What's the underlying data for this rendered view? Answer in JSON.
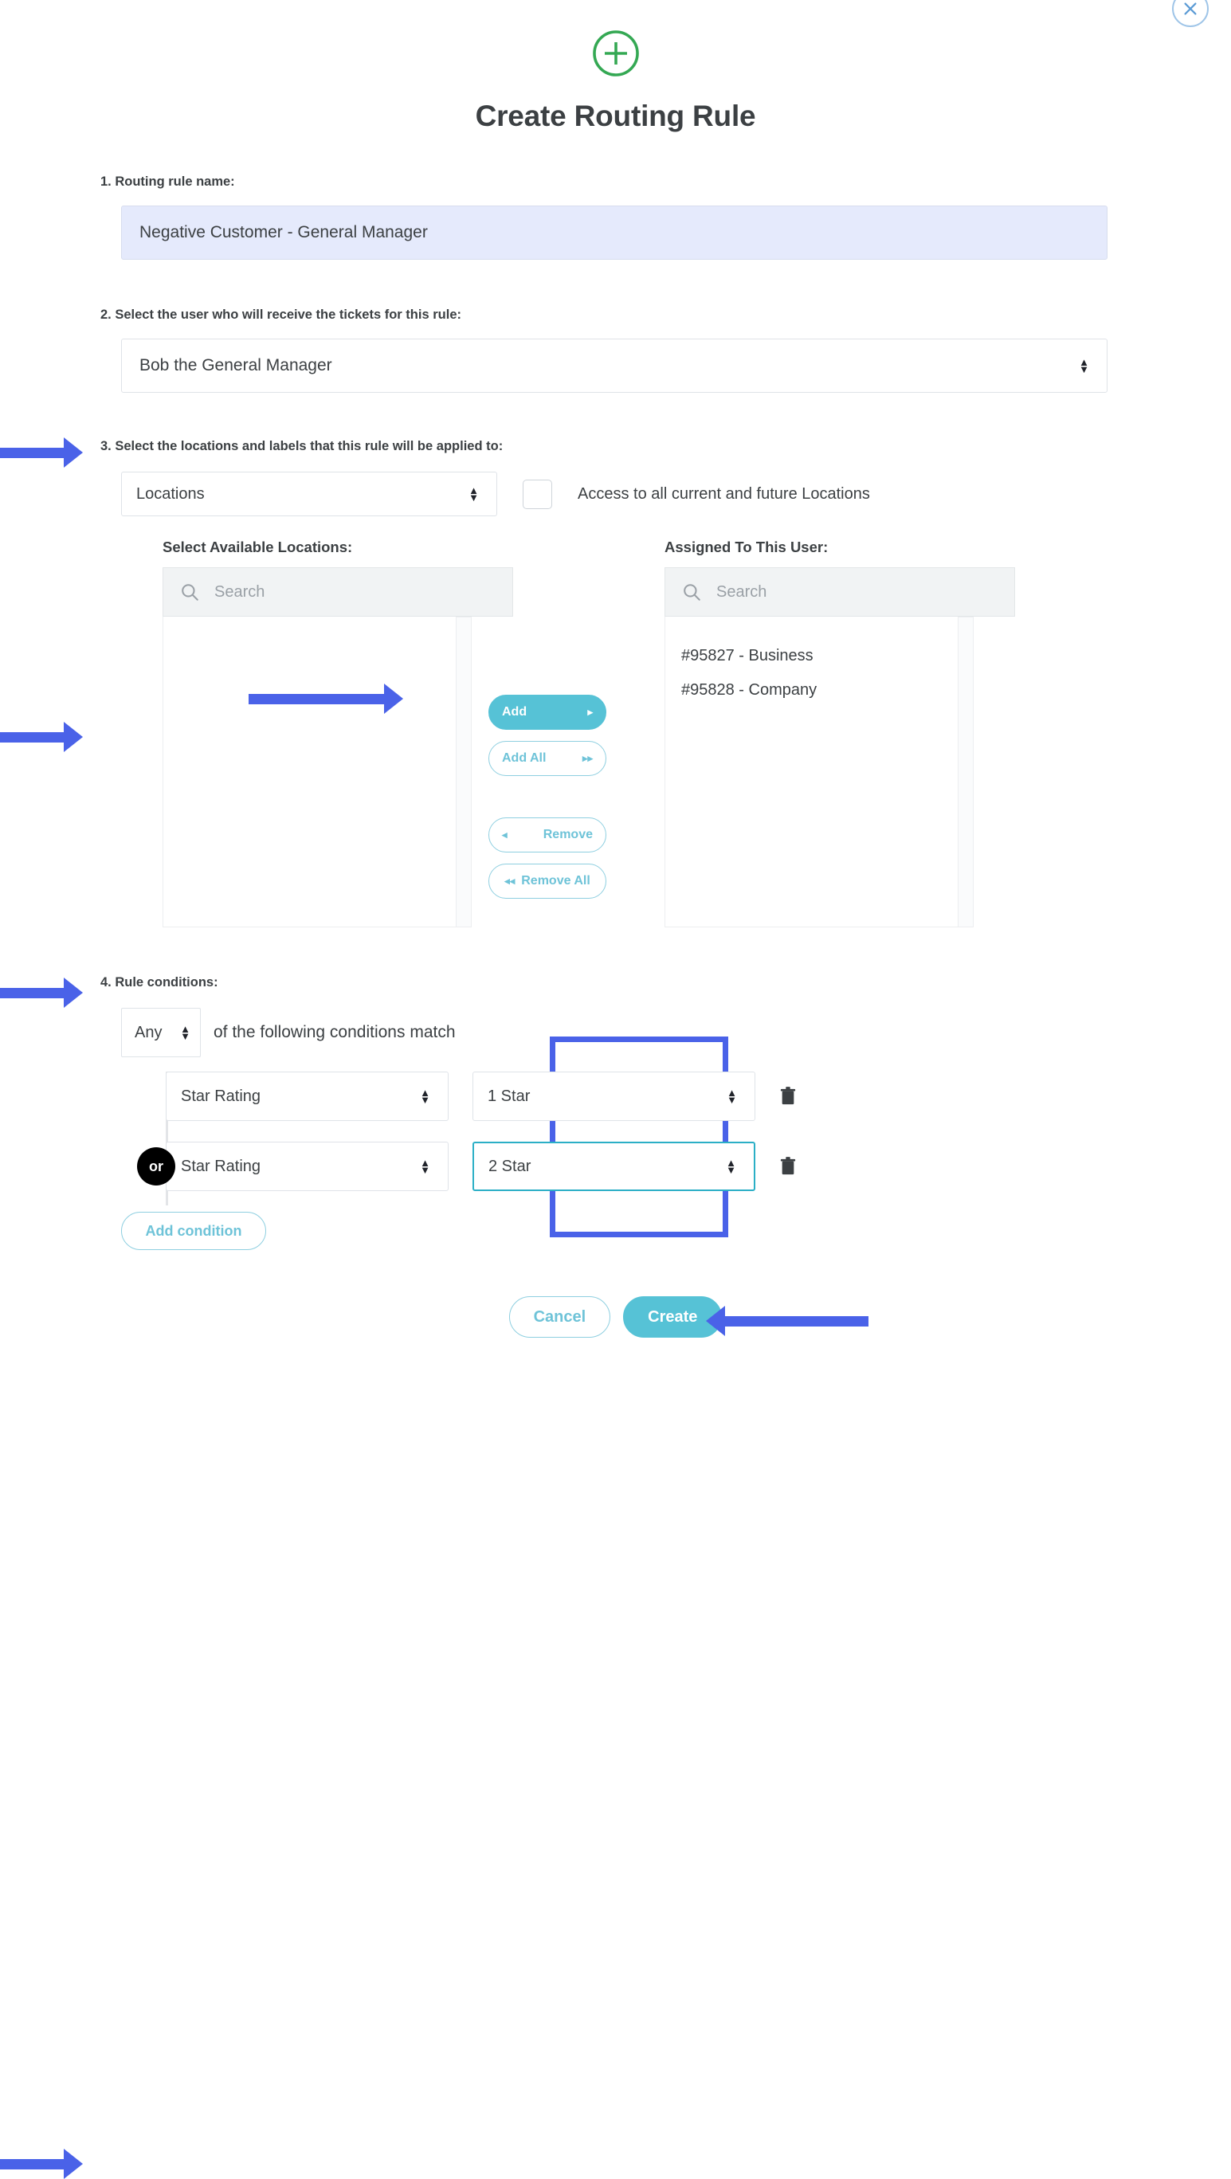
{
  "window": {
    "close_icon": "close-icon"
  },
  "header": {
    "plus_icon": "plus-circle-icon",
    "title": "Create Routing Rule",
    "accent_green": "#34a853"
  },
  "step1": {
    "label": "1. Routing rule name:",
    "value": "Negative Customer - General Manager",
    "highlight_bg": "#e5eafc"
  },
  "step2": {
    "label": "2. Select the user who will receive the tickets for this rule:",
    "value": "Bob the General Manager"
  },
  "step3": {
    "label": "3. Select the locations and labels that this rule will be applied to:",
    "type_value": "Locations",
    "checkbox_label": "Access to all current and future Locations",
    "checkbox_checked": false,
    "available": {
      "title": "Select Available Locations:",
      "search_placeholder": "Search",
      "search_icon": "search-icon",
      "items": []
    },
    "assigned": {
      "title": "Assigned To This User:",
      "search_placeholder": "Search",
      "search_icon": "search-icon",
      "items": [
        "#95827 - Business",
        "#95828 - Company"
      ]
    },
    "transfer_buttons": [
      {
        "label": "Add",
        "glyph": "▸",
        "glyph_side": "right",
        "filled": true
      },
      {
        "label": "Add All",
        "glyph": "▸▸",
        "glyph_side": "right",
        "filled": false
      },
      {
        "label": "Remove",
        "glyph": "◂",
        "glyph_side": "left",
        "filled": false
      },
      {
        "label": "Remove All",
        "glyph": "◂◂",
        "glyph_side": "left",
        "filled": false
      }
    ]
  },
  "step4": {
    "label": "4. Rule conditions:",
    "match_mode": "Any",
    "match_text": "of the following conditions match",
    "conditions": [
      {
        "field": "Star Rating",
        "value": "1 Star",
        "connector": "",
        "focused": false,
        "delete_icon": "trash-icon"
      },
      {
        "field": "Star Rating",
        "value": "2 Star",
        "connector": "or",
        "focused": true,
        "delete_icon": "trash-icon"
      }
    ],
    "add_condition_label": "Add condition"
  },
  "footer": {
    "cancel_label": "Cancel",
    "create_label": "Create"
  },
  "annotation": {
    "arrow_color": "#4a62e8",
    "highlight_color": "#4a62e8"
  }
}
